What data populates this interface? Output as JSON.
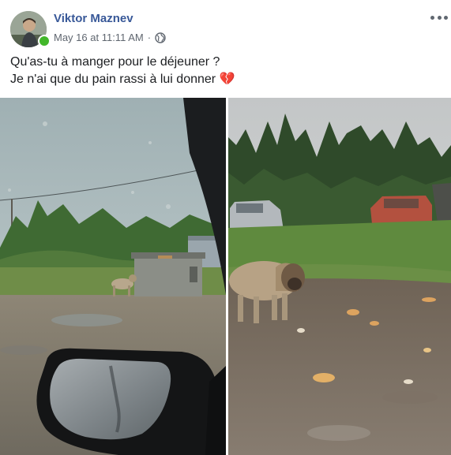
{
  "author": {
    "name": "Viktor Maznev",
    "online": true,
    "avatar_icon": "profile-photo"
  },
  "meta": {
    "timestamp": "May 16 at 11:11 AM",
    "separator": "·",
    "privacy_icon": "globe-icon"
  },
  "menu": {
    "icon": "more-options-icon"
  },
  "post": {
    "line1": "Qu'as-tu à manger pour le déjeuner ?",
    "line2": "Je n'ai que du pain rassi à lui donner",
    "emoji": "💔"
  },
  "photos": [
    {
      "name": "photo-dog-by-dumpster",
      "icon": "car-side-mirror"
    },
    {
      "name": "photo-dog-with-bread"
    }
  ],
  "colors": {
    "name_link": "#385898",
    "meta_text": "#606770",
    "online": "#42b72a",
    "heart": "#e0245e"
  }
}
